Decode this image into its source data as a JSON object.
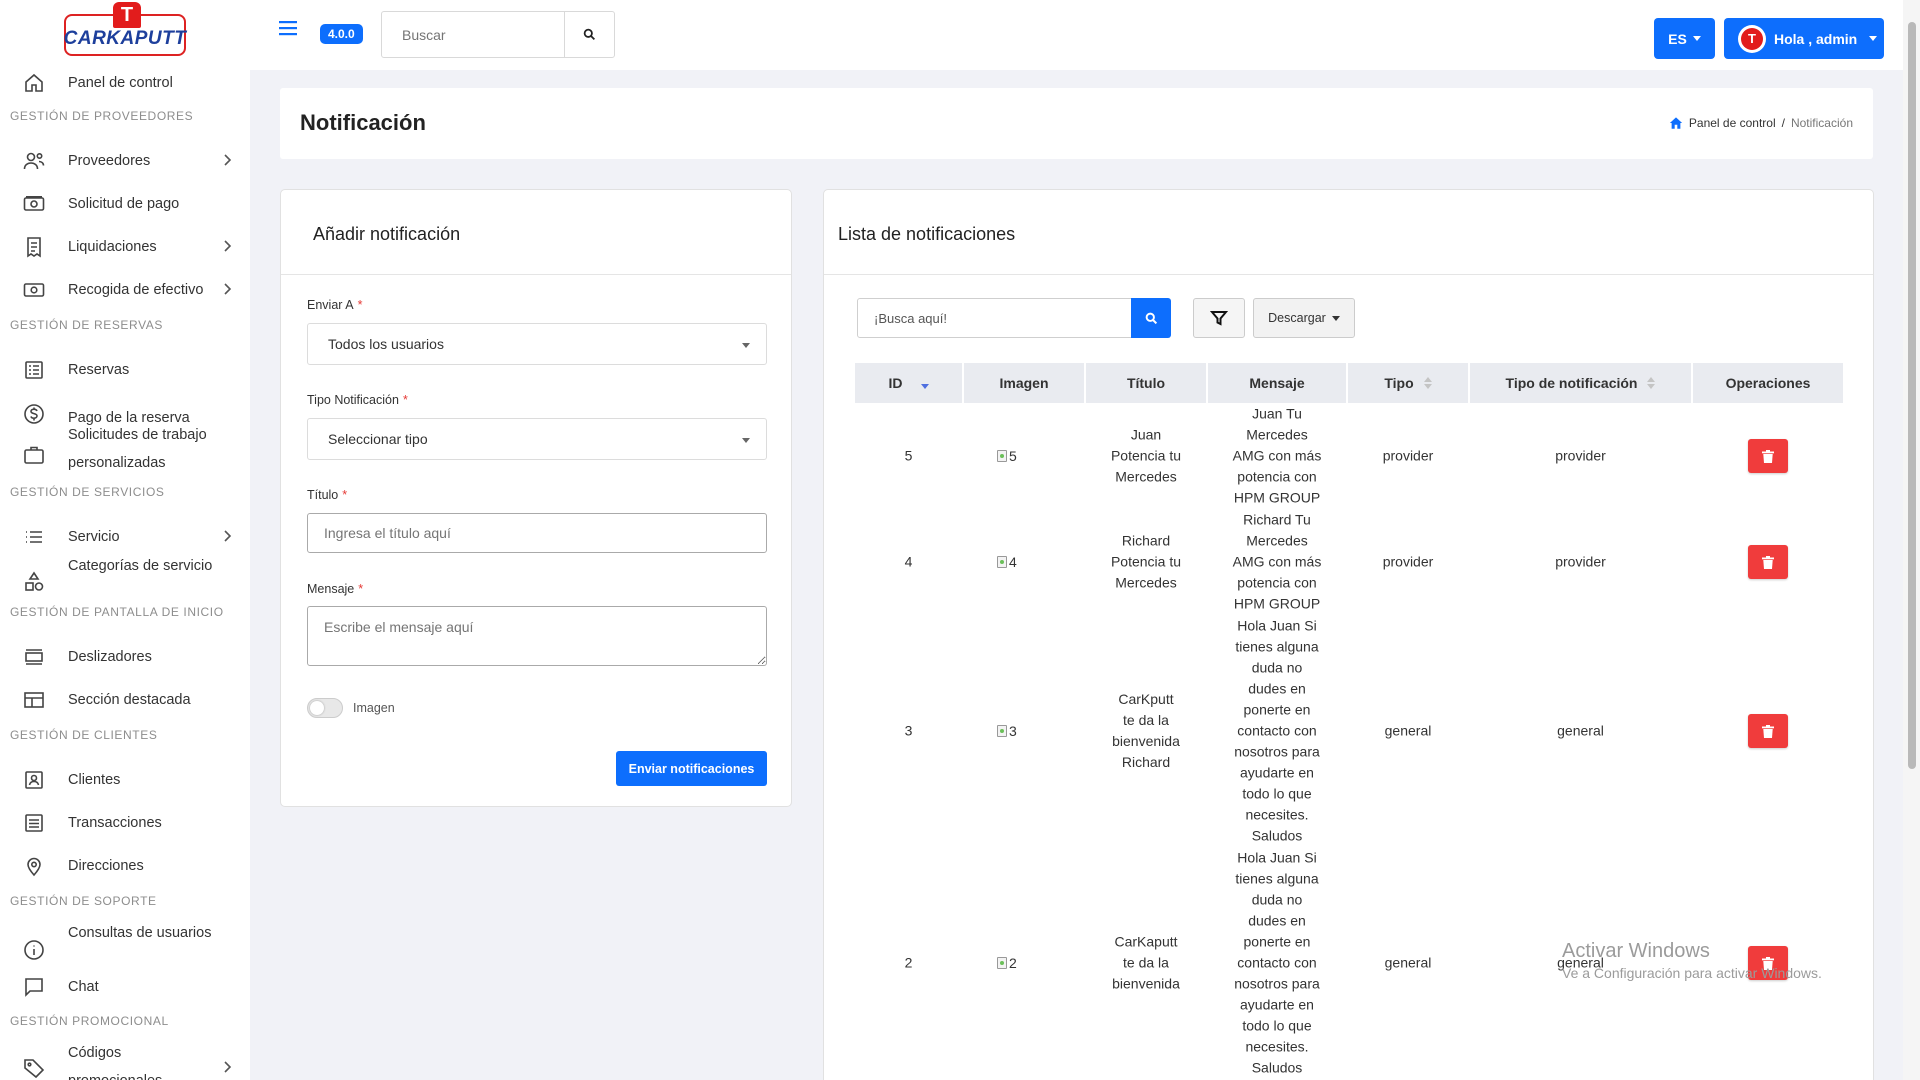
{
  "brand": {
    "logo_letter": "T",
    "logo_text": "CARKAPUTT"
  },
  "topbar": {
    "version": "4.0.0",
    "search_placeholder": "Buscar",
    "lang": "ES",
    "greeting": "Hola , admin",
    "avatar_letter": "T"
  },
  "sidebar": {
    "panel": "Panel de control",
    "sections": {
      "proveedores": "GESTIÓN DE PROVEEDORES",
      "reservas": "GESTIÓN DE RESERVAS",
      "servicios": "GESTIÓN DE SERVICIOS",
      "pantalla": "GESTIÓN DE PANTALLA DE INICIO",
      "clientes": "GESTIÓN DE CLIENTES",
      "soporte": "GESTIÓN DE SOPORTE",
      "promocional": "GESTIÓN PROMOCIONAL"
    },
    "items": {
      "proveedores": "Proveedores",
      "solicitud_pago": "Solicitud de pago",
      "liquidaciones": "Liquidaciones",
      "recogida": "Recogida de efectivo",
      "reservas": "Reservas",
      "pago_reserva": "Pago de la reserva",
      "solicitudes": "Solicitudes de trabajo personalizadas",
      "servicio": "Servicio",
      "categorias": "Categorías de servicio",
      "deslizadores": "Deslizadores",
      "seccion_destacada": "Sección destacada",
      "clientes": "Clientes",
      "transacciones": "Transacciones",
      "direcciones": "Direcciones",
      "consultas": "Consultas de usuarios",
      "chat": "Chat",
      "codigos": "Códigos promocionales"
    }
  },
  "page": {
    "title": "Notificación",
    "breadcrumb_home": "Panel de control",
    "breadcrumb_sep": "/",
    "breadcrumb_current": "Notificación"
  },
  "form": {
    "title": "Añadir notificación",
    "send_to_label": "Enviar A",
    "send_to_value": "Todos los usuarios",
    "type_label": "Tipo Notificación",
    "type_value": "Seleccionar tipo",
    "title_label": "Título",
    "title_placeholder": "Ingresa el título aquí",
    "message_label": "Mensaje",
    "message_placeholder": "Escribe el mensaje aquí",
    "image_label": "Imagen",
    "required_mark": "*",
    "submit": "Enviar notificaciones"
  },
  "list": {
    "title": "Lista de notificaciones",
    "search_placeholder": "¡Busca aquí!",
    "download": "Descargar",
    "columns": {
      "id": "ID",
      "image": "Imagen",
      "title": "Título",
      "message": "Mensaje",
      "type": "Tipo",
      "notif_type": "Tipo de notificación",
      "operations": "Operaciones"
    },
    "rows": [
      {
        "id": "5",
        "image": "5",
        "title": "Juan\nPotencia tu\nMercedes",
        "message": "Juan Tu\nMercedes\nAMG con más\npotencia con\nHPM GROUP",
        "type": "provider",
        "notif_type": "provider"
      },
      {
        "id": "4",
        "image": "4",
        "title": "Richard\nPotencia tu\nMercedes",
        "message": "Richard Tu\nMercedes\nAMG con más\npotencia con\nHPM GROUP",
        "type": "provider",
        "notif_type": "provider"
      },
      {
        "id": "3",
        "image": "3",
        "title": "CarKputt\nte da la\nbienvenida\nRichard",
        "message": "Hola Juan Si\ntienes alguna\nduda no\ndudes en\nponerte en\ncontacto con\nnosotros para\nayudarte en\ntodo lo que\nnecesites.\nSaludos",
        "type": "general",
        "notif_type": "general"
      },
      {
        "id": "2",
        "image": "2",
        "title": "CarKaputt\nte da la\nbienvenida",
        "message": "Hola Juan Si\ntienes alguna\nduda no\ndudes en\nponerte en\ncontacto con\nnosotros para\nayudarte en\ntodo lo que\nnecesites.\nSaludos",
        "type": "general",
        "notif_type": "general"
      }
    ]
  },
  "watermark": {
    "line1": "Activar Windows",
    "line2": "Ve a Configuración para activar Windows."
  }
}
